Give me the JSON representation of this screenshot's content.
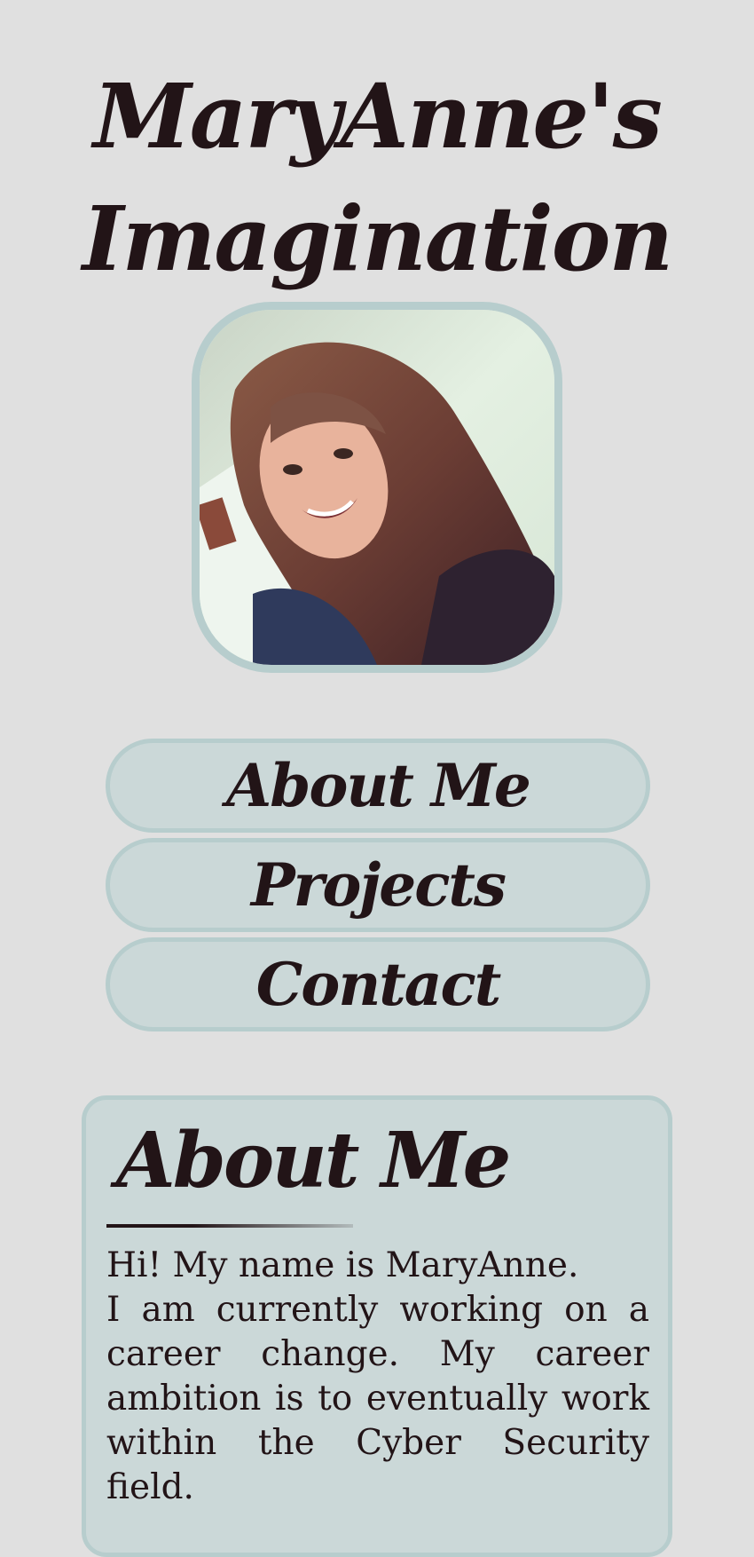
{
  "header": {
    "title_line1": "MaryAnne's",
    "title_line2": "Imagination"
  },
  "profile": {
    "image": "profile-photo"
  },
  "nav": {
    "items": [
      {
        "label": "About Me"
      },
      {
        "label": "Projects"
      },
      {
        "label": "Contact"
      }
    ]
  },
  "about": {
    "heading": "About Me",
    "greeting": "Hi! My name is MaryAnne.",
    "paragraph": "I am currently working on a career change. My career ambition is to eventually work within the Cyber Security field."
  },
  "colors": {
    "background": "#e0e0e0",
    "panel": "#cbd8d8",
    "border": "#b7cdcd",
    "text": "#221417"
  }
}
